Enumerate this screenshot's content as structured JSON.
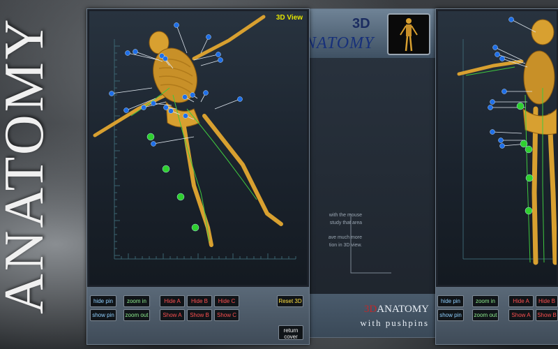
{
  "side_title": "ANATOMY",
  "left_viewer": {
    "view_label": "3D View",
    "buttons": {
      "hide_pin": "hide pin",
      "show_pin": "show pin",
      "zoom_in": "zoom in",
      "zoom_out": "zoom out",
      "hide_a": "Hide A",
      "show_a": "Show A",
      "hide_b": "Hide B",
      "show_b": "Show B",
      "hide_c": "Hide C",
      "show_c": "Show C",
      "reset_3d": "Reset 3D",
      "return_cover_1": "return",
      "return_cover_2": "cover"
    }
  },
  "center_panel": {
    "brand_3d": "3D",
    "brand_anatomy": "NATOMY",
    "text_line1": "with the mouse",
    "text_line2": "study that area",
    "text_line3": "ave much more",
    "text_line4": "tion in 3D view.",
    "footer_3d": "3D",
    "footer_anatomy": "ANATOMY",
    "footer_sub": "with pushpins"
  },
  "right_viewer": {
    "buttons": {
      "hide_pin": "hide pin",
      "show_pin": "show pin",
      "zoom_in": "zoom in",
      "zoom_out": "zoom out",
      "hide_a": "Hide A",
      "show_a": "Show A",
      "hide_b": "Hide B",
      "show_b": "Show B"
    }
  },
  "colors": {
    "pin_blue": "#1f6fe8",
    "pin_green": "#2fd02f",
    "bone": "#d8a030",
    "nerve": "#3fc83f"
  }
}
